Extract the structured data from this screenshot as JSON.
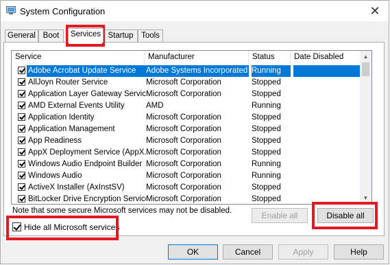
{
  "window": {
    "title": "System Configuration",
    "close_glyph": "✕"
  },
  "tabs": [
    {
      "label": "General"
    },
    {
      "label": "Boot"
    },
    {
      "label": "Services",
      "active": true
    },
    {
      "label": "Startup"
    },
    {
      "label": "Tools"
    }
  ],
  "table": {
    "columns": [
      "Service",
      "Manufacturer",
      "Status",
      "Date Disabled"
    ],
    "rows": [
      {
        "service": "Adobe Acrobat Update Service",
        "manufacturer": "Adobe Systems Incorporated",
        "status": "Running",
        "date": "",
        "checked": true,
        "selected": true
      },
      {
        "service": "AllJoyn Router Service",
        "manufacturer": "Microsoft Corporation",
        "status": "Stopped",
        "date": "",
        "checked": true
      },
      {
        "service": "Application Layer Gateway Service",
        "manufacturer": "Microsoft Corporation",
        "status": "Stopped",
        "date": "",
        "checked": true
      },
      {
        "service": "AMD External Events Utility",
        "manufacturer": "AMD",
        "status": "Running",
        "date": "",
        "checked": true
      },
      {
        "service": "Application Identity",
        "manufacturer": "Microsoft Corporation",
        "status": "Stopped",
        "date": "",
        "checked": true
      },
      {
        "service": "Application Management",
        "manufacturer": "Microsoft Corporation",
        "status": "Stopped",
        "date": "",
        "checked": true
      },
      {
        "service": "App Readiness",
        "manufacturer": "Microsoft Corporation",
        "status": "Stopped",
        "date": "",
        "checked": true
      },
      {
        "service": "AppX Deployment Service (AppX...",
        "manufacturer": "Microsoft Corporation",
        "status": "Stopped",
        "date": "",
        "checked": true
      },
      {
        "service": "Windows Audio Endpoint Builder",
        "manufacturer": "Microsoft Corporation",
        "status": "Running",
        "date": "",
        "checked": true
      },
      {
        "service": "Windows Audio",
        "manufacturer": "Microsoft Corporation",
        "status": "Running",
        "date": "",
        "checked": true
      },
      {
        "service": "ActiveX Installer (AxInstSV)",
        "manufacturer": "Microsoft Corporation",
        "status": "Stopped",
        "date": "",
        "checked": true
      },
      {
        "service": "BitLocker Drive Encryption Service",
        "manufacturer": "Microsoft Corporation",
        "status": "Stopped",
        "date": "",
        "checked": true
      }
    ]
  },
  "note": "Note that some secure Microsoft services may not be disabled.",
  "hide_ms": {
    "label": "Hide all Microsoft services",
    "checked": true
  },
  "buttons": {
    "enable_all": "Enable all",
    "disable_all": "Disable all",
    "ok": "OK",
    "cancel": "Cancel",
    "apply": "Apply",
    "help": "Help"
  },
  "colors": {
    "selection": "#0078d7",
    "highlight_red": "#e01b24"
  }
}
